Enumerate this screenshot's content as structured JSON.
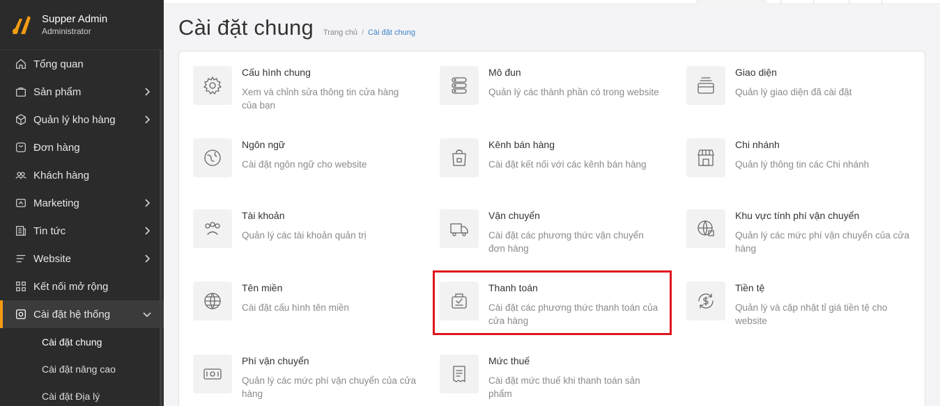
{
  "sidebar": {
    "user_name": "Supper Admin",
    "user_role": "Administrator",
    "items": [
      {
        "label": "Tổng quan",
        "icon": "home-icon",
        "chevron": false
      },
      {
        "label": "Sản phẩm",
        "icon": "bag-icon",
        "chevron": true
      },
      {
        "label": "Quản lý kho hàng",
        "icon": "box-icon",
        "chevron": true
      },
      {
        "label": "Đơn hàng",
        "icon": "order-icon",
        "chevron": false
      },
      {
        "label": "Khách hàng",
        "icon": "users-icon",
        "chevron": false
      },
      {
        "label": "Marketing",
        "icon": "marketing-icon",
        "chevron": true
      },
      {
        "label": "Tin tức",
        "icon": "news-icon",
        "chevron": true
      },
      {
        "label": "Website",
        "icon": "menu-lines-icon",
        "chevron": true
      },
      {
        "label": "Kết nối mở rộng",
        "icon": "grid-icon",
        "chevron": false
      },
      {
        "label": "Cài đặt hệ thống",
        "icon": "settings-icon",
        "chevron": true,
        "active": true
      }
    ],
    "sub_items": [
      "Cài đặt chung",
      "Cài đặt nâng cao",
      "Cài đặt Địa lý"
    ],
    "accent": "#f39c12"
  },
  "page": {
    "title": "Cài đặt chung",
    "breadcrumb": {
      "home": "Trang chủ",
      "separator": "/",
      "current": "Cài đặt chung"
    }
  },
  "tiles": [
    {
      "title": "Cấu hình chung",
      "desc": "Xem và chỉnh sửa thông tin cửa hàng của bạn",
      "icon": "gear-icon"
    },
    {
      "title": "Mô đun",
      "desc": "Quản lý các thành phần có trong website",
      "icon": "modules-icon"
    },
    {
      "title": "Giao diện",
      "desc": "Quản lý giao diện đã cài đặt",
      "icon": "theme-icon"
    },
    {
      "title": "Ngôn ngữ",
      "desc": "Cài đặt ngôn ngữ cho website",
      "icon": "language-icon"
    },
    {
      "title": "Kênh bán hàng",
      "desc": "Cài đặt kết nối với các kênh bán hàng",
      "icon": "shopping-bag-icon"
    },
    {
      "title": "Chi nhánh",
      "desc": "Quản lý thông tin các Chi nhánh",
      "icon": "store-icon"
    },
    {
      "title": "Tài khoản",
      "desc": "Quản lý các tài khoản quản trị",
      "icon": "accounts-icon"
    },
    {
      "title": "Vận chuyển",
      "desc": "Cài đặt các phương thức vận chuyển đơn hàng",
      "icon": "truck-icon"
    },
    {
      "title": "Khu vực tính phí vận chuyển",
      "desc": "Quản lý các mức phí vận chuyển của cửa hàng",
      "icon": "globe-box-icon"
    },
    {
      "title": "Tên miền",
      "desc": "Cài đặt cấu hình tên miền",
      "icon": "globe-icon"
    },
    {
      "title": "Thanh toán",
      "desc": "Cài đặt các phương thức thanh toán của cửa hàng",
      "icon": "payment-icon"
    },
    {
      "title": "Tiền tệ",
      "desc": "Quản lý và cập nhật tỉ giá tiền tệ cho website",
      "icon": "currency-icon"
    },
    {
      "title": "Phí vận chuyển",
      "desc": "Quản lý các mức phí vận chuyển của cửa hàng",
      "icon": "banknote-icon"
    },
    {
      "title": "Mức thuế",
      "desc": "Cài đặt mức thuế khi thanh toán sản phẩm",
      "icon": "receipt-icon"
    }
  ],
  "highlight_color": "#e0141e"
}
